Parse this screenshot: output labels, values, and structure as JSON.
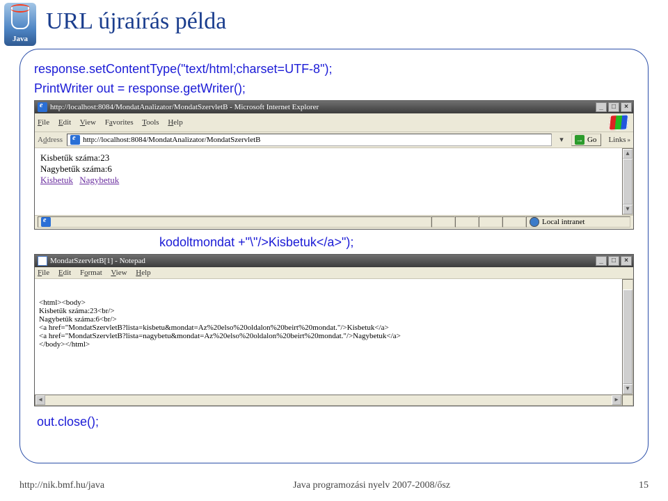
{
  "slide": {
    "logo_text": "Java",
    "title": "URL újraírás példa",
    "code_line1": "response.setContentType(\"text/html;charset=UTF-8\");",
    "code_line2": "PrintWriter out = response.getWriter();",
    "code_frag": "kodoltmondat +\"\\\"/>Kisbetuk</a>\");",
    "code_close": "out.close();"
  },
  "footer": {
    "left": "http://nik.bmf.hu/java",
    "center": "Java programozási nyelv 2007-2008/ősz",
    "page": "15"
  },
  "ie": {
    "title": "http://localhost:8084/MondatAnalizator/MondatSzervletB - Microsoft Internet Explorer",
    "menus": {
      "file": "File",
      "edit": "Edit",
      "view": "View",
      "fav": "Favorites",
      "tools": "Tools",
      "help": "Help"
    },
    "addr_label": "Address",
    "url": "http://localhost:8084/MondatAnalizator/MondatSzervletB",
    "go": "Go",
    "links": "Links",
    "body": {
      "line1": "Kisbetűk száma:23",
      "line2": "Nagybetűk száma:6",
      "link1": "Kisbetuk",
      "link2": "Nagybetuk"
    },
    "zone": "Local intranet"
  },
  "notepad": {
    "title": "MondatSzervletB[1] - Notepad",
    "menus": {
      "file": "File",
      "edit": "Edit",
      "format": "Format",
      "view": "View",
      "help": "Help"
    },
    "content": "<html><body>\nKisbetűk száma:23<br/>\nNagybetűk száma:6<br/>\n<a href=\"MondatSzervletB?lista=kisbetu&mondat=Az%20elso%20oldalon%20beirt%20mondat.\"/>Kisbetuk</a>\n<a href=\"MondatSzervletB?lista=nagybetu&mondat=Az%20elso%20oldalon%20beirt%20mondat.\"/>Nagybetuk</a>\n</body></html>"
  }
}
